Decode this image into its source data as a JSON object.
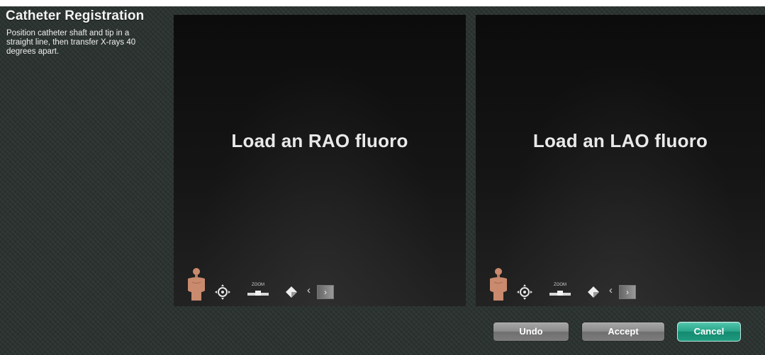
{
  "title": "Catheter Registration",
  "instructions": "Position catheter shaft and tip in a straight line, then transfer X-rays 40 degrees apart.",
  "viewports": {
    "left": {
      "message": "Load an RAO fluoro"
    },
    "right": {
      "message": "Load an LAO fluoro"
    }
  },
  "toolbar": {
    "icons": [
      "body-orientation-icon",
      "target-pan-icon",
      "zoom-icon",
      "contrast-diamond-icon",
      "previous-arrow-icon",
      "panel-toggle-icon"
    ],
    "zoom_label": "ZOOM",
    "prev_glyph": "‹",
    "panel_glyph": "›"
  },
  "buttons": {
    "undo": "Undo",
    "accept": "Accept",
    "cancel": "Cancel"
  },
  "colors": {
    "background": "#2b3331",
    "viewport": "#111111",
    "cancel_accent": "#2aa58a",
    "button_gray": "#8c8c8c"
  }
}
